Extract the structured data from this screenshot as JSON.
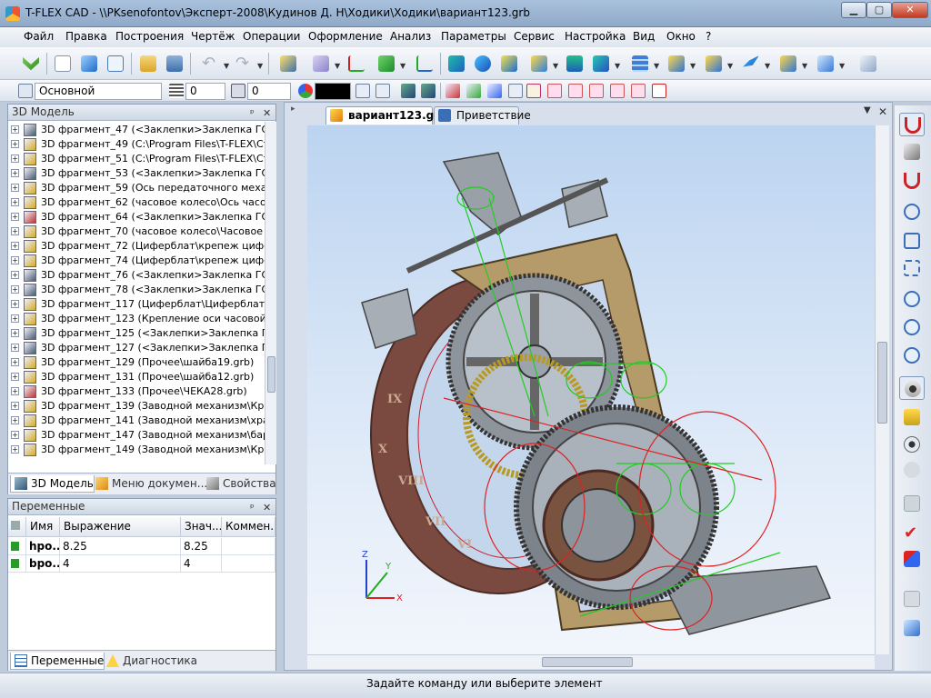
{
  "window": {
    "title": "T-FLEX CAD - \\\\PKsenofontov\\Эксперт-2008\\Кудинов Д. Н\\Ходики\\Ходики\\вариант123.grb"
  },
  "menu": [
    "Файл",
    "Правка",
    "Построения",
    "Чертёж",
    "Операции",
    "Оформление",
    "Анализ",
    "Параметры",
    "Сервис",
    "Настройка",
    "Вид",
    "Окно",
    "?"
  ],
  "toolbar2": {
    "layer_value": "Основной",
    "level_value": "0",
    "priority_value": "0",
    "color": "#000000"
  },
  "model_panel": {
    "title": "3D Модель",
    "items": [
      {
        "label": "3D фрагмент_47 (<Заклепки>Заклепка ГОСТ"
      },
      {
        "label": "3D фрагмент_49 (C:\\Program Files\\T-FLEX\\Стан"
      },
      {
        "label": "3D фрагмент_51 (C:\\Program Files\\T-FLEX\\Стан"
      },
      {
        "label": "3D фрагмент_53 (<Заклепки>Заклепка ГОСТ"
      },
      {
        "label": "3D фрагмент_59 (Ось передаточного механизм"
      },
      {
        "label": "3D фрагмент_62 (часовое колесо\\Ось часового"
      },
      {
        "label": "3D фрагмент_64 (<Заклепки>Заклепка ГОСТ"
      },
      {
        "label": "3D фрагмент_70 (часовое колесо\\Часовое ко"
      },
      {
        "label": "3D фрагмент_72 (Циферблат\\крепеж цифербл"
      },
      {
        "label": "3D фрагмент_74 (Циферблат\\крепеж цифербл"
      },
      {
        "label": "3D фрагмент_76 (<Заклепки>Заклепка ГОСТ"
      },
      {
        "label": "3D фрагмент_78 (<Заклепки>Заклепка ГОСТ"
      },
      {
        "label": "3D фрагмент_117 (Циферблат\\Циферблат.grb)"
      },
      {
        "label": "3D фрагмент_123 (Крепление оси часовой стр"
      },
      {
        "label": "3D фрагмент_125 (<Заклепки>Заклепка ГОСТ"
      },
      {
        "label": "3D фрагмент_127 (<Заклепки>Заклепка ГОСТ"
      },
      {
        "label": "3D фрагмент_129 (Прочее\\шайба19.grb)"
      },
      {
        "label": "3D фрагмент_131 (Прочее\\шайба12.grb)"
      },
      {
        "label": "3D фрагмент_133 (Прочее\\ЧЕКА28.grb)"
      },
      {
        "label": "3D фрагмент_139 (Заводной механизм\\Крыш"
      },
      {
        "label": "3D фрагмент_141 (Заводной механизм\\храпое"
      },
      {
        "label": "3D фрагмент_147 (Заводной механизм\\бараба"
      },
      {
        "label": "3D фрагмент_149 (Заводной механизм\\Крыше"
      }
    ],
    "tabs": [
      "3D Модель",
      "Меню докумен...",
      "Свойства"
    ]
  },
  "variables_panel": {
    "title": "Переменные",
    "columns": [
      "Имя",
      "Выражение",
      "Знач...",
      "Коммен..."
    ],
    "rows": [
      {
        "name": "hpo...",
        "expr": "8.25",
        "value": "8.25",
        "comment": ""
      },
      {
        "name": "bpo...",
        "expr": "4",
        "value": "4",
        "comment": ""
      }
    ],
    "tabs": [
      "Переменные",
      "Диагностика"
    ]
  },
  "doc_tabs": [
    "вариант123.grb",
    "Приветствие"
  ],
  "axes": {
    "x": "X",
    "y": "Y",
    "z": "Z"
  },
  "dial_numerals": [
    "IX",
    "X",
    "VIII",
    "VII",
    "VI"
  ],
  "status": {
    "text": "Задайте команду или выберите элемент"
  }
}
